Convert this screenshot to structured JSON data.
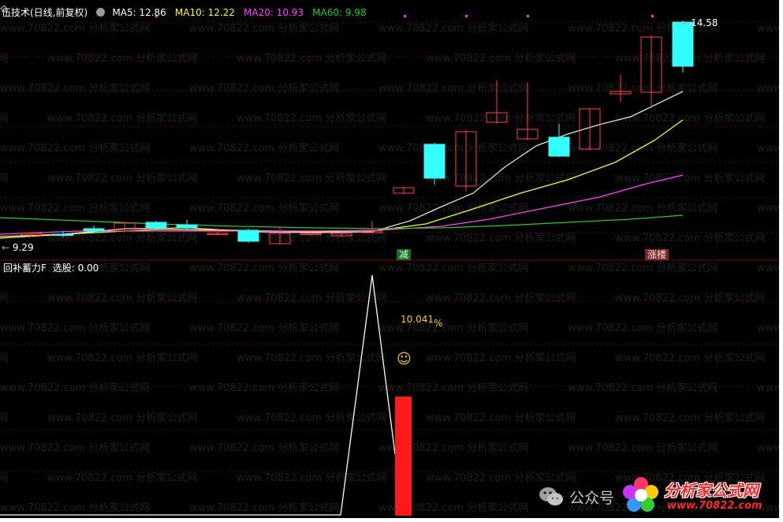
{
  "header": {
    "title": "伍技术(日线,前复权)",
    "ma_labels": [
      {
        "label": "MA5: 12.86",
        "color": "#ffffff"
      },
      {
        "label": "MA10: 12.22",
        "color": "#ffff00"
      },
      {
        "label": "MA20: 10.93",
        "color": "#ff44ff"
      },
      {
        "label": "MA60: 9.98",
        "color": "#22cc22"
      }
    ]
  },
  "main_chart": {
    "high_label": "14.58",
    "low_label": "9.29",
    "signal_reduce": "减",
    "signal_limit_up": "涨楼",
    "colors": {
      "up": "#ff4444",
      "down": "#33ffff",
      "ma5": "#e0e0e0",
      "ma10": "#ffff00",
      "ma20": "#ff44ff",
      "ma60": "#22cc22"
    }
  },
  "indicator": {
    "title": "回补蓄力F",
    "select_label": "选股: 0.00",
    "pct_label": "10.041",
    "pct_suffix": "%",
    "smiley": "☺",
    "bar_color": "#ff1a1a"
  },
  "watermark": {
    "text": "www.70822.com 分析家公式网"
  },
  "wechat": {
    "label": "公众号"
  },
  "logo": {
    "name": "分析家公式网",
    "url": "www.70822.com"
  }
}
